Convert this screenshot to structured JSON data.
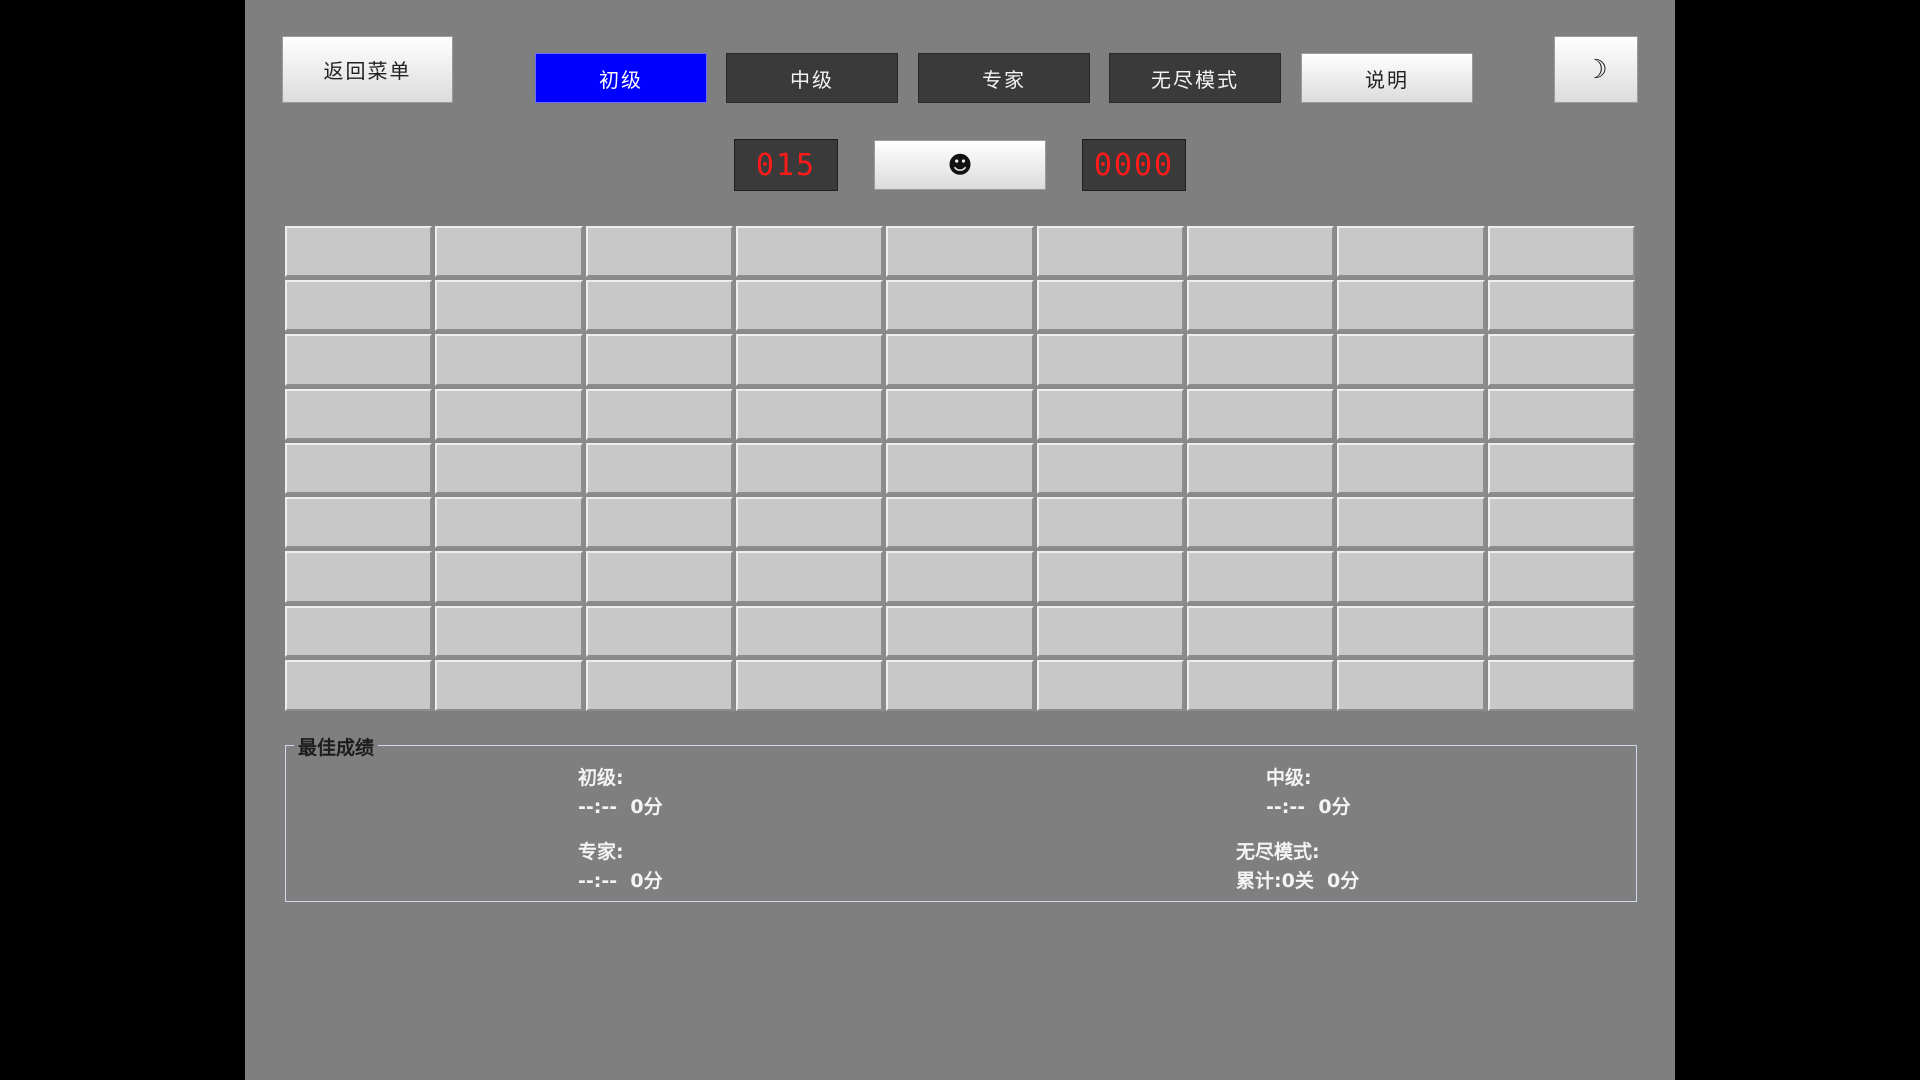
{
  "toolbar": {
    "back_label": "返回菜单",
    "levels": [
      "初级",
      "中级",
      "专家",
      "无尽模式"
    ],
    "active_level": "初级",
    "help_label": "说明",
    "theme_icon": "moon-icon",
    "theme_glyph": "☽"
  },
  "status": {
    "mine_count": "015",
    "face_icon": "smiley-face-icon",
    "face_glyph": "☻",
    "timer": "0000"
  },
  "board": {
    "rows": 9,
    "cols": 9,
    "state": "all-unrevealed"
  },
  "best_scores": {
    "title": "最佳成绩",
    "beginner_label": "初级:",
    "beginner_value": "--:--  0分",
    "intermediate_label": "中级:",
    "intermediate_value": "--:--  0分",
    "expert_label": "专家:",
    "expert_value": "--:--  0分",
    "endless_label": "无尽模式:",
    "endless_value": "累计:0关  0分"
  },
  "colors": {
    "background": "#7f7f7f",
    "active_button": "#0000ff",
    "counter_text": "#ff1a1a",
    "cell": "#c8c8c8"
  }
}
